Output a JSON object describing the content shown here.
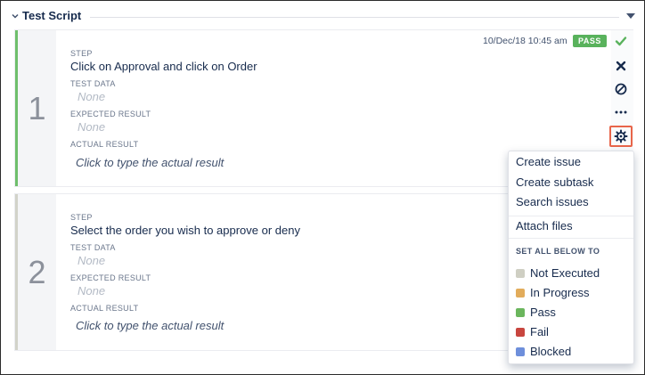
{
  "section": {
    "title": "Test Script"
  },
  "steps": [
    {
      "number": "1",
      "step_label": "STEP",
      "step_text": "Click on Approval and click on Order",
      "test_data_label": "TEST DATA",
      "test_data": "None",
      "expected_label": "EXPECTED RESULT",
      "expected": "None",
      "actual_label": "ACTUAL RESULT",
      "actual_placeholder": "Click to type the actual result",
      "timestamp": "10/Dec/18 10:45 am",
      "status": "PASS"
    },
    {
      "number": "2",
      "step_label": "STEP",
      "step_text": "Select the order you wish to approve or deny",
      "test_data_label": "TEST DATA",
      "test_data": "None",
      "expected_label": "EXPECTED RESULT",
      "expected": "None",
      "actual_label": "ACTUAL RESULT",
      "actual_placeholder": "Click to type the actual result"
    }
  ],
  "actions": [
    "check-icon",
    "x-icon",
    "block-icon",
    "more-icon",
    "gear-icon"
  ],
  "menu": {
    "items": [
      "Create issue",
      "Create subtask",
      "Search issues"
    ],
    "attach": "Attach files",
    "heading": "SET ALL BELOW TO",
    "statuses": [
      {
        "label": "Not Executed",
        "color": "#cfcfc3"
      },
      {
        "label": "In Progress",
        "color": "#e2ac5b"
      },
      {
        "label": "Pass",
        "color": "#6bb65d"
      },
      {
        "label": "Fail",
        "color": "#c8463f"
      },
      {
        "label": "Blocked",
        "color": "#6e8fdb"
      }
    ]
  },
  "colors": {
    "pass_badge": "#59b25c",
    "gear_highlight": "#e8654a"
  }
}
